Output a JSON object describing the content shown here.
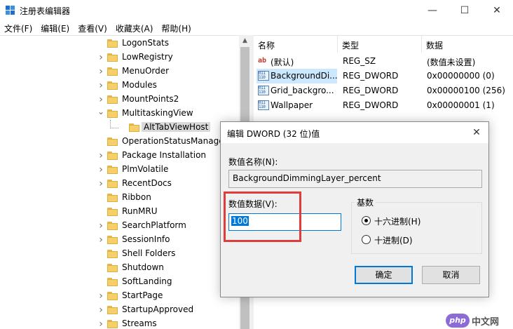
{
  "window": {
    "title": "注册表编辑器",
    "minimize": "—",
    "maximize": "☐",
    "close": "✕"
  },
  "menu": [
    "文件(F)",
    "编辑(E)",
    "查看(V)",
    "收藏夹(A)",
    "帮助(H)"
  ],
  "tree": {
    "items": [
      {
        "label": "LogonStats",
        "expandable": false,
        "selected": false,
        "depth": 0
      },
      {
        "label": "LowRegistry",
        "expandable": true,
        "selected": false,
        "depth": 0
      },
      {
        "label": "MenuOrder",
        "expandable": true,
        "selected": false,
        "depth": 0
      },
      {
        "label": "Modules",
        "expandable": true,
        "selected": false,
        "depth": 0
      },
      {
        "label": "MountPoints2",
        "expandable": true,
        "selected": false,
        "depth": 0
      },
      {
        "label": "MultitaskingView",
        "expandable": true,
        "expanded": true,
        "selected": false,
        "depth": 0
      },
      {
        "label": "AltTabViewHost",
        "expandable": false,
        "selected": true,
        "depth": 1
      },
      {
        "label": "OperationStatusManage",
        "expandable": false,
        "selected": false,
        "depth": 0
      },
      {
        "label": "Package Installation",
        "expandable": true,
        "selected": false,
        "depth": 0
      },
      {
        "label": "PlmVolatile",
        "expandable": true,
        "selected": false,
        "depth": 0
      },
      {
        "label": "RecentDocs",
        "expandable": true,
        "selected": false,
        "depth": 0
      },
      {
        "label": "Ribbon",
        "expandable": false,
        "selected": false,
        "depth": 0
      },
      {
        "label": "RunMRU",
        "expandable": false,
        "selected": false,
        "depth": 0
      },
      {
        "label": "SearchPlatform",
        "expandable": true,
        "selected": false,
        "depth": 0
      },
      {
        "label": "SessionInfo",
        "expandable": true,
        "selected": false,
        "depth": 0
      },
      {
        "label": "Shell Folders",
        "expandable": false,
        "selected": false,
        "depth": 0
      },
      {
        "label": "Shutdown",
        "expandable": false,
        "selected": false,
        "depth": 0
      },
      {
        "label": "SoftLanding",
        "expandable": false,
        "selected": false,
        "depth": 0
      },
      {
        "label": "StartPage",
        "expandable": true,
        "selected": false,
        "depth": 0
      },
      {
        "label": "StartupApproved",
        "expandable": true,
        "selected": false,
        "depth": 0
      },
      {
        "label": "Streams",
        "expandable": true,
        "selected": false,
        "depth": 0
      }
    ]
  },
  "values": {
    "columns": {
      "name": "名称",
      "type": "类型",
      "data": "数据"
    },
    "rows": [
      {
        "icon": "string-value-icon",
        "icon_glyph": "ab",
        "name": "(默认)",
        "type": "REG_SZ",
        "data": "(数值未设置)",
        "selected": false
      },
      {
        "icon": "binary-value-icon",
        "icon_glyph": "011\n110",
        "name": "BackgroundDi...",
        "type": "REG_DWORD",
        "data": "0x00000000 (0)",
        "selected": true
      },
      {
        "icon": "binary-value-icon",
        "icon_glyph": "011\n110",
        "name": "Grid_backgro...",
        "type": "REG_DWORD",
        "data": "0x00000100 (256)",
        "selected": false
      },
      {
        "icon": "binary-value-icon",
        "icon_glyph": "011\n110",
        "name": "Wallpaper",
        "type": "REG_DWORD",
        "data": "0x00000001 (1)",
        "selected": false
      }
    ]
  },
  "dialog": {
    "title": "编辑 DWORD (32 位)值",
    "close": "✕",
    "name_label": "数值名称(N):",
    "name_value": "BackgroundDimmingLayer_percent",
    "data_label": "数值数据(V):",
    "data_value": "100",
    "base_label": "基数",
    "radio_hex": "十六进制(H)",
    "radio_dec": "十进制(D)",
    "selected_base": "hex",
    "ok": "确定",
    "cancel": "取消"
  },
  "watermark": {
    "logo": "php",
    "text": "中文网"
  },
  "colors": {
    "selection": "#cce8ff",
    "accent": "#0078d7",
    "highlight_border": "#e03c3c"
  }
}
